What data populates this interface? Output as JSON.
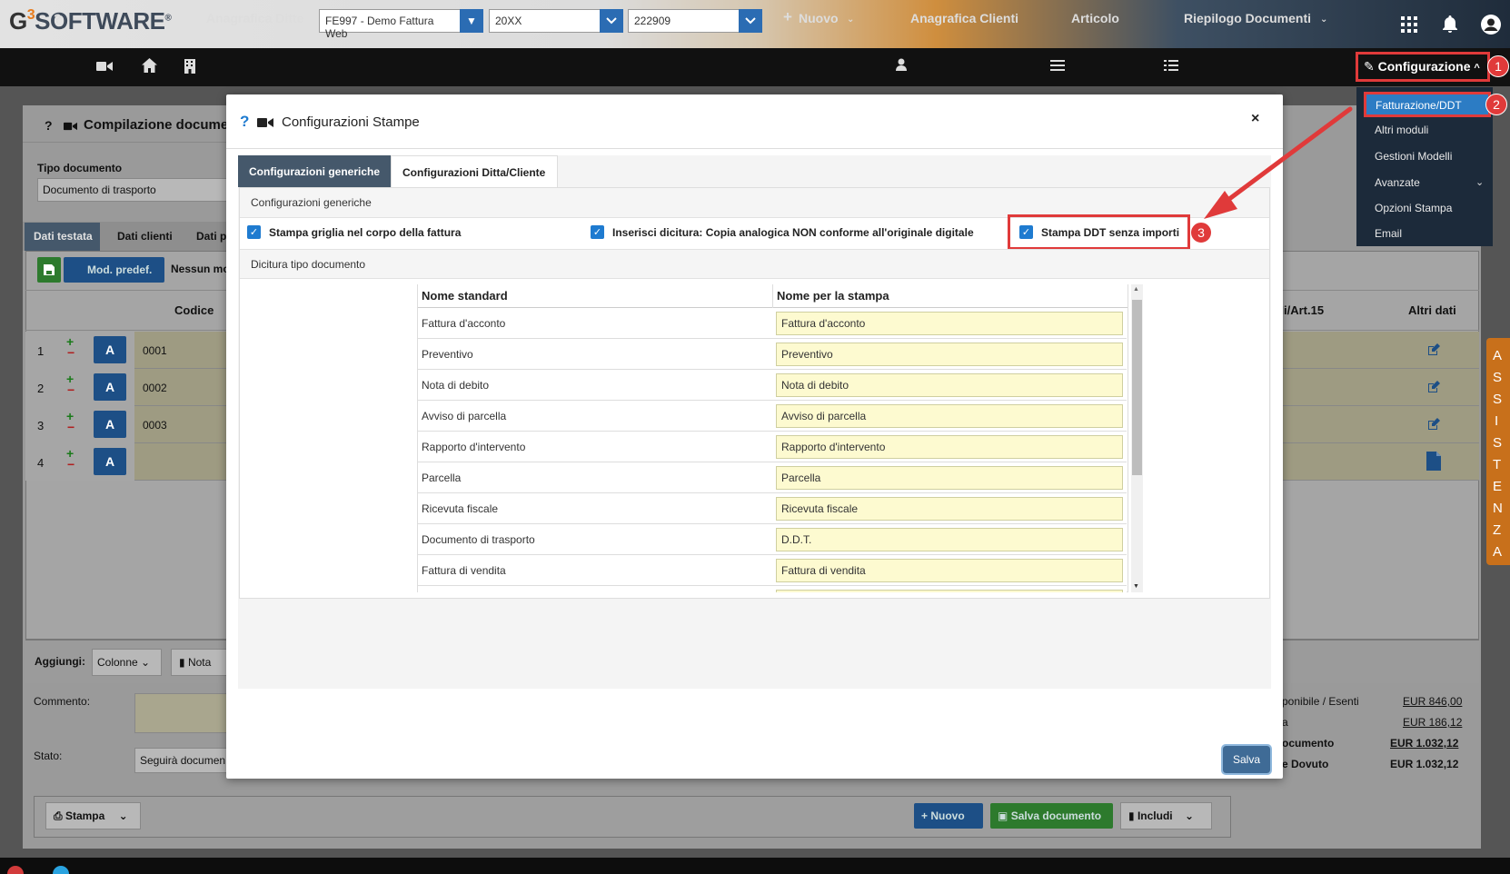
{
  "header": {
    "logo_g": "G",
    "logo_3": "3",
    "logo_text": "SOFTWARE",
    "logo_reg": "®",
    "icons": [
      "grid-icon",
      "bell-icon",
      "user-icon"
    ]
  },
  "nav": {
    "anagrafica_ditte": "Anagrafica Ditte",
    "company_select": "FE997 - Demo Fattura Web",
    "year_select": "20XX",
    "code_select": "222909",
    "nuovo": "Nuovo",
    "anagrafica_clienti": "Anagrafica Clienti",
    "articolo": "Articolo",
    "riepilogo": "Riepilogo Documenti",
    "configurazione": "Configurazione"
  },
  "dropdown": {
    "items": [
      "Fatturazione/DDT",
      "Altri moduli",
      "Gestioni Modelli",
      "Avanzate",
      "Opzioni Stampa",
      "Email"
    ]
  },
  "badges": [
    "1",
    "2",
    "3"
  ],
  "background": {
    "page_title": "Compilazione docume",
    "tipo_label": "Tipo documento",
    "tipo_value": "Documento di trasporto",
    "tabs": [
      "Dati testata",
      "Dati clienti",
      "Dati p"
    ],
    "mod_predef": "Mod. predef.",
    "nessun": "Nessun mo",
    "col_codice": "Codice",
    "col_iva": "/Ni/Art.15",
    "col_altri": "Altri dati",
    "rows": [
      {
        "n": "1",
        "a": "A",
        "code": "0001"
      },
      {
        "n": "2",
        "a": "A",
        "code": "0002"
      },
      {
        "n": "3",
        "a": "A",
        "code": "0003"
      },
      {
        "n": "4",
        "a": "A",
        "code": ""
      }
    ],
    "aggiungi": "Aggiungi:",
    "colonne": "Colonne",
    "nota": "Nota",
    "commento": "Commento:",
    "stato": "Stato:",
    "stato_value": "Seguirà documen",
    "totals": [
      {
        "label": "ponibile / Esenti",
        "value": "EUR 846,00"
      },
      {
        "label": "a",
        "value": "EUR 186,12"
      },
      {
        "label": "ocumento",
        "value": "EUR 1.032,12"
      },
      {
        "label": "e Dovuto",
        "value": "EUR 1.032,12"
      }
    ],
    "stampa": "Stampa",
    "nuovo": "Nuovo",
    "salva_documento": "Salva documento",
    "includi": "Includi"
  },
  "assist_letters": [
    "A",
    "S",
    "S",
    "I",
    "S",
    "T",
    "E",
    "N",
    "Z",
    "A"
  ],
  "modal": {
    "title": "Configurazioni Stampe",
    "close": "×",
    "tabs": [
      "Configurazioni generiche",
      "Configurazioni Ditta/Cliente"
    ],
    "section_general": "Configurazioni generiche",
    "checkboxes": [
      "Stampa griglia nel corpo della fattura",
      "Inserisci dicitura: Copia analogica NON conforme all'originale digitale",
      "Stampa DDT senza importi"
    ],
    "section_dicitura": "Dicitura tipo documento",
    "table": {
      "headers": [
        "Nome standard",
        "Nome per la stampa"
      ],
      "rows": [
        [
          "Fattura d'acconto",
          "Fattura d'acconto"
        ],
        [
          "Preventivo",
          "Preventivo"
        ],
        [
          "Nota di debito",
          "Nota di debito"
        ],
        [
          "Avviso di parcella",
          "Avviso di parcella"
        ],
        [
          "Rapporto d'intervento",
          "Rapporto d'intervento"
        ],
        [
          "Parcella",
          "Parcella"
        ],
        [
          "Ricevuta fiscale",
          "Ricevuta fiscale"
        ],
        [
          "Documento di trasporto",
          "D.D.T."
        ],
        [
          "Fattura di vendita",
          "Fattura di vendita"
        ]
      ]
    },
    "save": "Salva"
  },
  "colors": {
    "accent_blue": "#2b6cb3",
    "highlight_red": "#e03a3a",
    "assist_orange": "#c8701b",
    "input_yellow": "#fdfad0"
  }
}
